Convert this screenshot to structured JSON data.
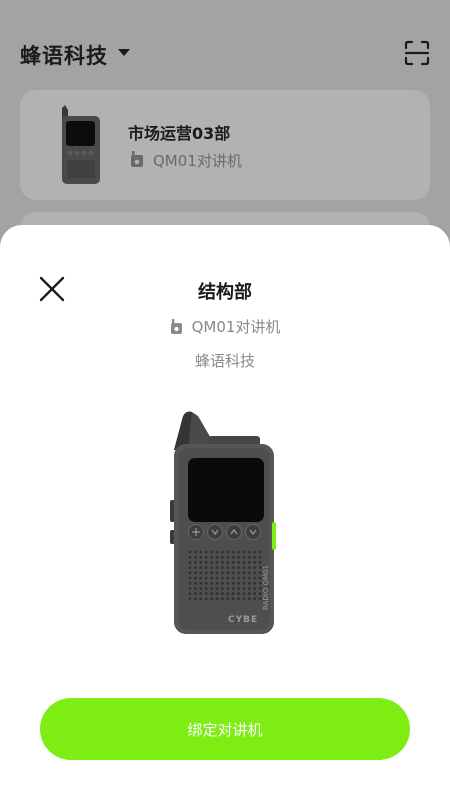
{
  "header": {
    "org_name": "蜂语科技",
    "caret_icon": "caret-down-icon",
    "scan_icon": "scan-icon"
  },
  "device_list": [
    {
      "name": "市场运营03部",
      "model": "QM01对讲机",
      "model_icon": "walkie-talkie-icon"
    }
  ],
  "sheet": {
    "close_icon": "close-icon",
    "title": "结构部",
    "model": "QM01对讲机",
    "model_icon": "walkie-talkie-icon",
    "org": "蜂语科技",
    "device_image": "walkie-talkie-image",
    "device_brand_marking": "CYBE RADIO QM01",
    "bind_button_label": "绑定对讲机"
  },
  "colors": {
    "accent": "#7ded14",
    "overlay_background": "#a3a3a3",
    "card_background": "#b2b2b2",
    "sheet_background": "#ffffff",
    "secondary_text": "#8a8a8a"
  }
}
